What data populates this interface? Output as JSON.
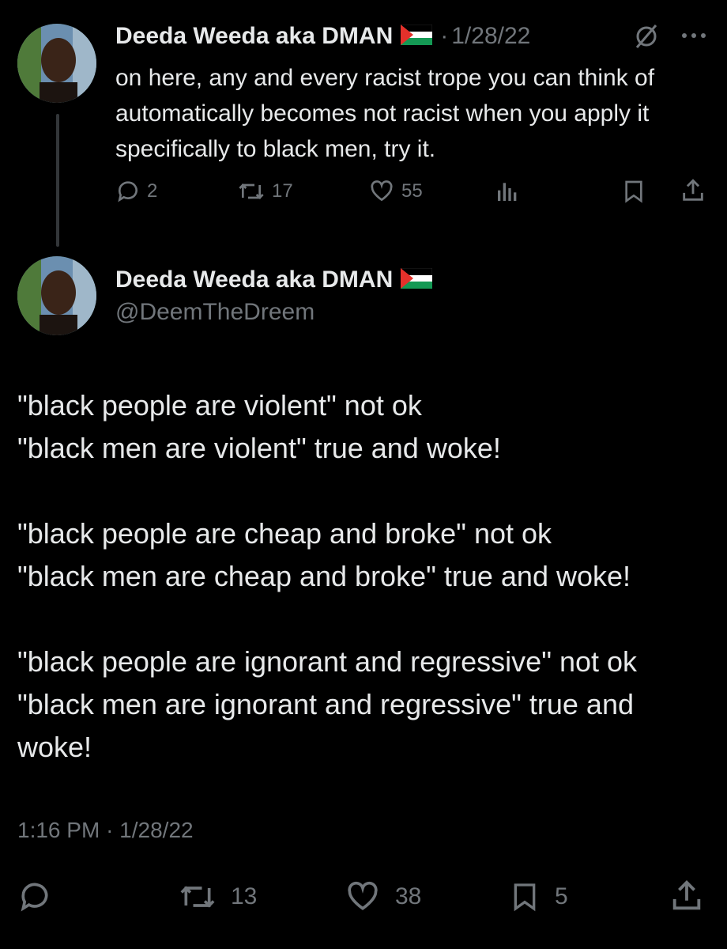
{
  "reply_tweet": {
    "display_name": "Deeda Weeda aka DMAN",
    "separator": "·",
    "date": "1/28/22",
    "text": "on here, any and every racist trope you can think of automatically becomes not racist when you apply it specifically to black men, try it.",
    "reply_count": "2",
    "repost_count": "17",
    "like_count": "55"
  },
  "main_tweet": {
    "display_name": "Deeda Weeda aka DMAN",
    "handle": "@DeemTheDreem",
    "lines": [
      "\"black people are violent\" not ok",
      "\"black men are violent\" true and woke!",
      "\"black people are cheap and broke\" not ok",
      "\"black men are cheap and broke\" true and woke!",
      "\"black people are ignorant and regressive\" not ok",
      "\"black men are ignorant and regressive\" true and woke!"
    ],
    "time": "1:16 PM",
    "separator": "·",
    "date": "1/28/22",
    "repost_count": "13",
    "like_count": "38",
    "bookmark_count": "5"
  },
  "icons": {
    "reply": "reply-icon",
    "repost": "repost-icon",
    "like": "heart-icon",
    "views": "analytics-icon",
    "bookmark": "bookmark-icon",
    "share": "share-icon",
    "grok": "grok-icon",
    "more": "more-icon",
    "flag": "palestine-flag-icon"
  },
  "colors": {
    "background": "#000000",
    "text": "#e7e9ea",
    "secondary": "#71767b",
    "thread_line": "#333639"
  }
}
